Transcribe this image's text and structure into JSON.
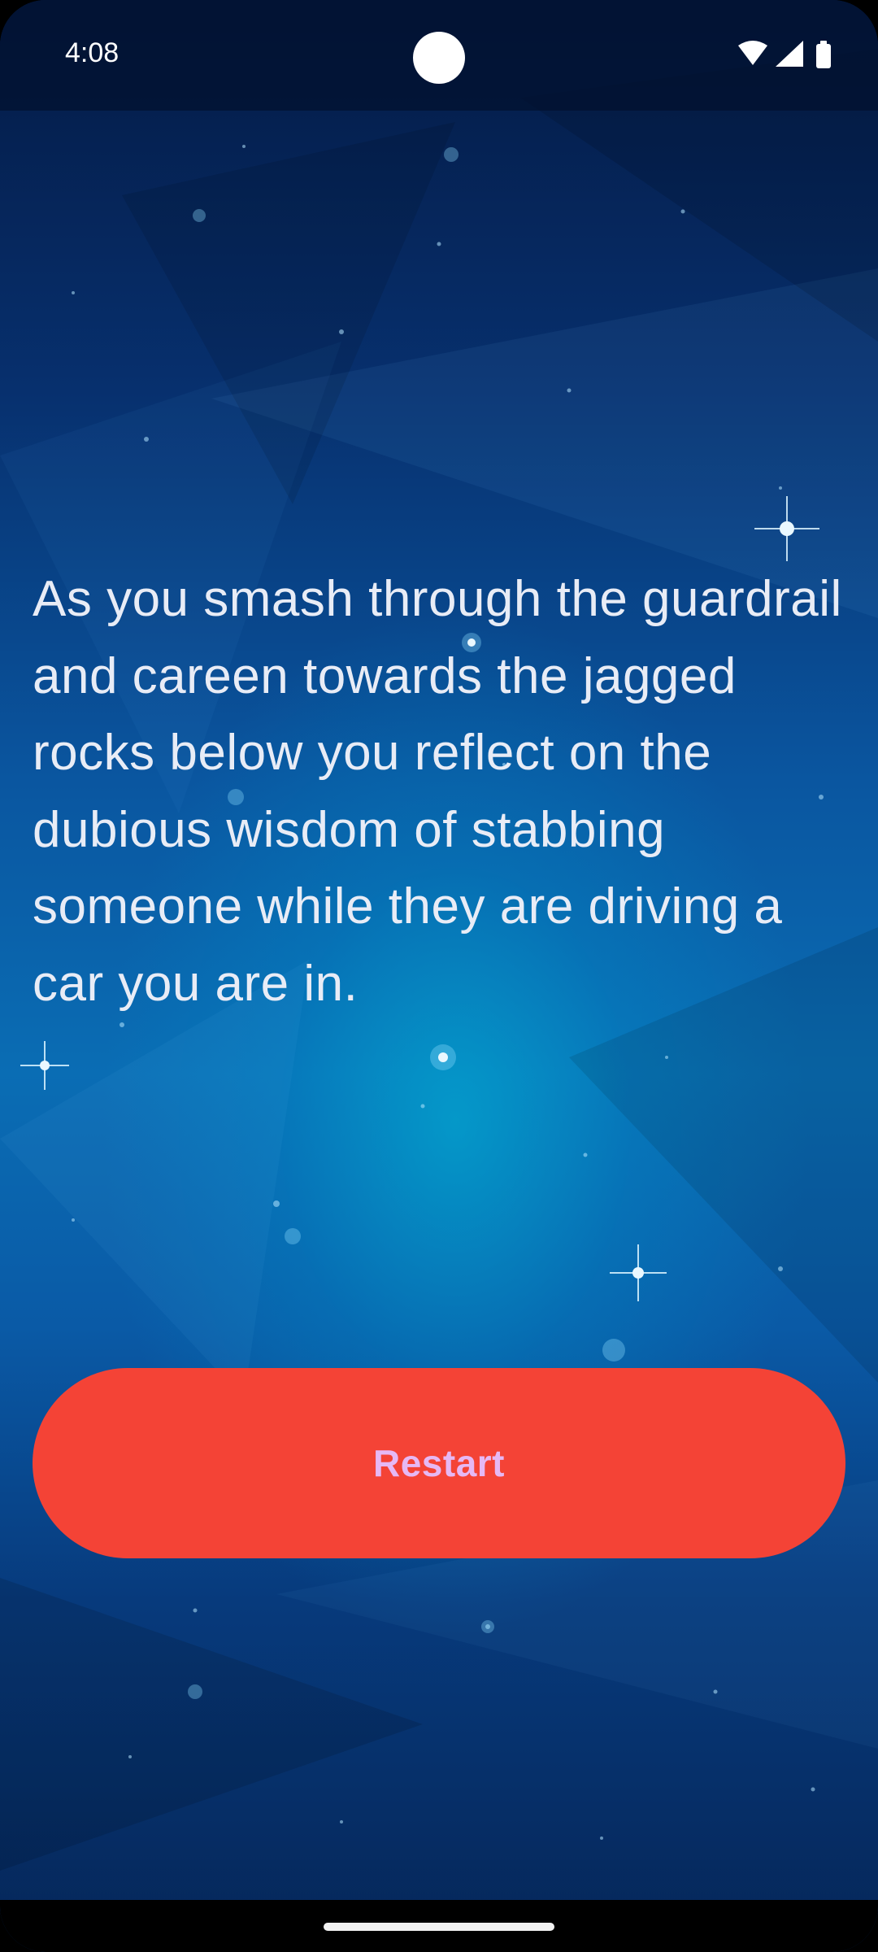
{
  "status_bar": {
    "time": "4:08",
    "icons": [
      "wifi-icon",
      "cellular-signal-icon",
      "battery-icon"
    ]
  },
  "story": {
    "text": "As you smash through the guardrail and careen towards the jagged rocks below you reflect on the dubious wisdom of stabbing someone while they are driving a car you are in."
  },
  "actions": {
    "restart_label": "Restart"
  },
  "colors": {
    "button": "#f44336",
    "button_text": "#e6b8f4",
    "story_text": "#e8ecf6",
    "background_top": "#041a44",
    "background_glow": "#00bedc"
  }
}
